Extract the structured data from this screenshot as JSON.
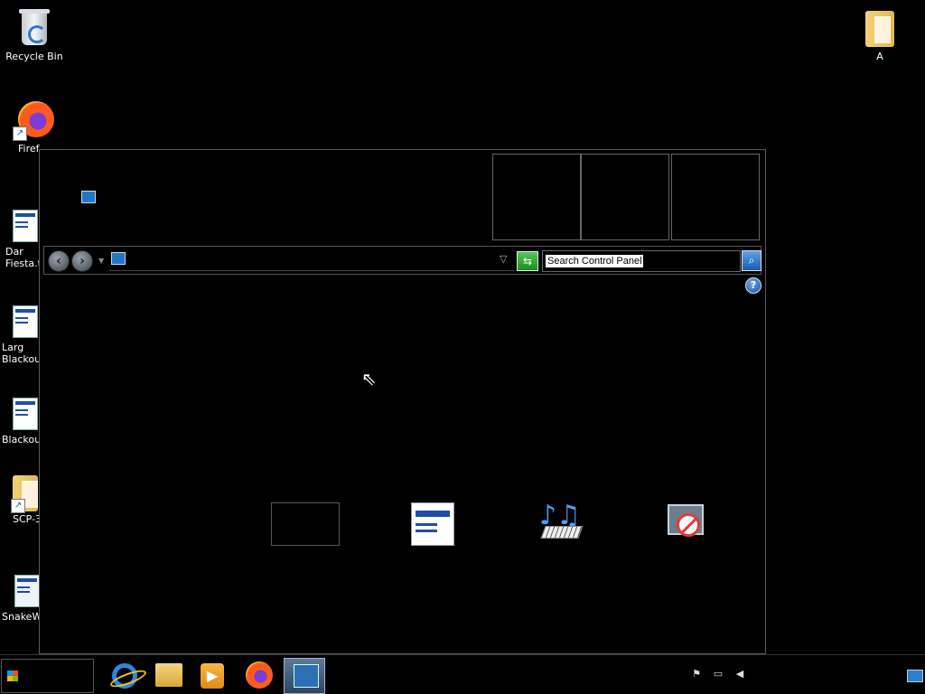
{
  "desktop": {
    "icons": [
      {
        "label": "Recycle Bin",
        "icon": "recycle-bin-icon"
      },
      {
        "label": "Firef",
        "icon": "firefox-icon"
      },
      {
        "label": "Dar\nFiesta.t",
        "icon": "document-icon"
      },
      {
        "label": "Larg\nBlackout",
        "icon": "document-icon"
      },
      {
        "label": "Blackout",
        "icon": "document-icon"
      },
      {
        "label": "SCP-3",
        "icon": "archive-icon"
      },
      {
        "label": "SnakeW",
        "icon": "setup-icon"
      },
      {
        "label": "A",
        "icon": "folder-icon"
      }
    ]
  },
  "window": {
    "search_placeholder": "Search Control Panel",
    "help_glyph": "?"
  },
  "taskbar": {
    "pinned": [
      "internet-explorer-icon",
      "file-explorer-icon",
      "media-player-icon",
      "firefox-icon",
      "control-panel-icon"
    ],
    "active": "control-panel-icon"
  }
}
